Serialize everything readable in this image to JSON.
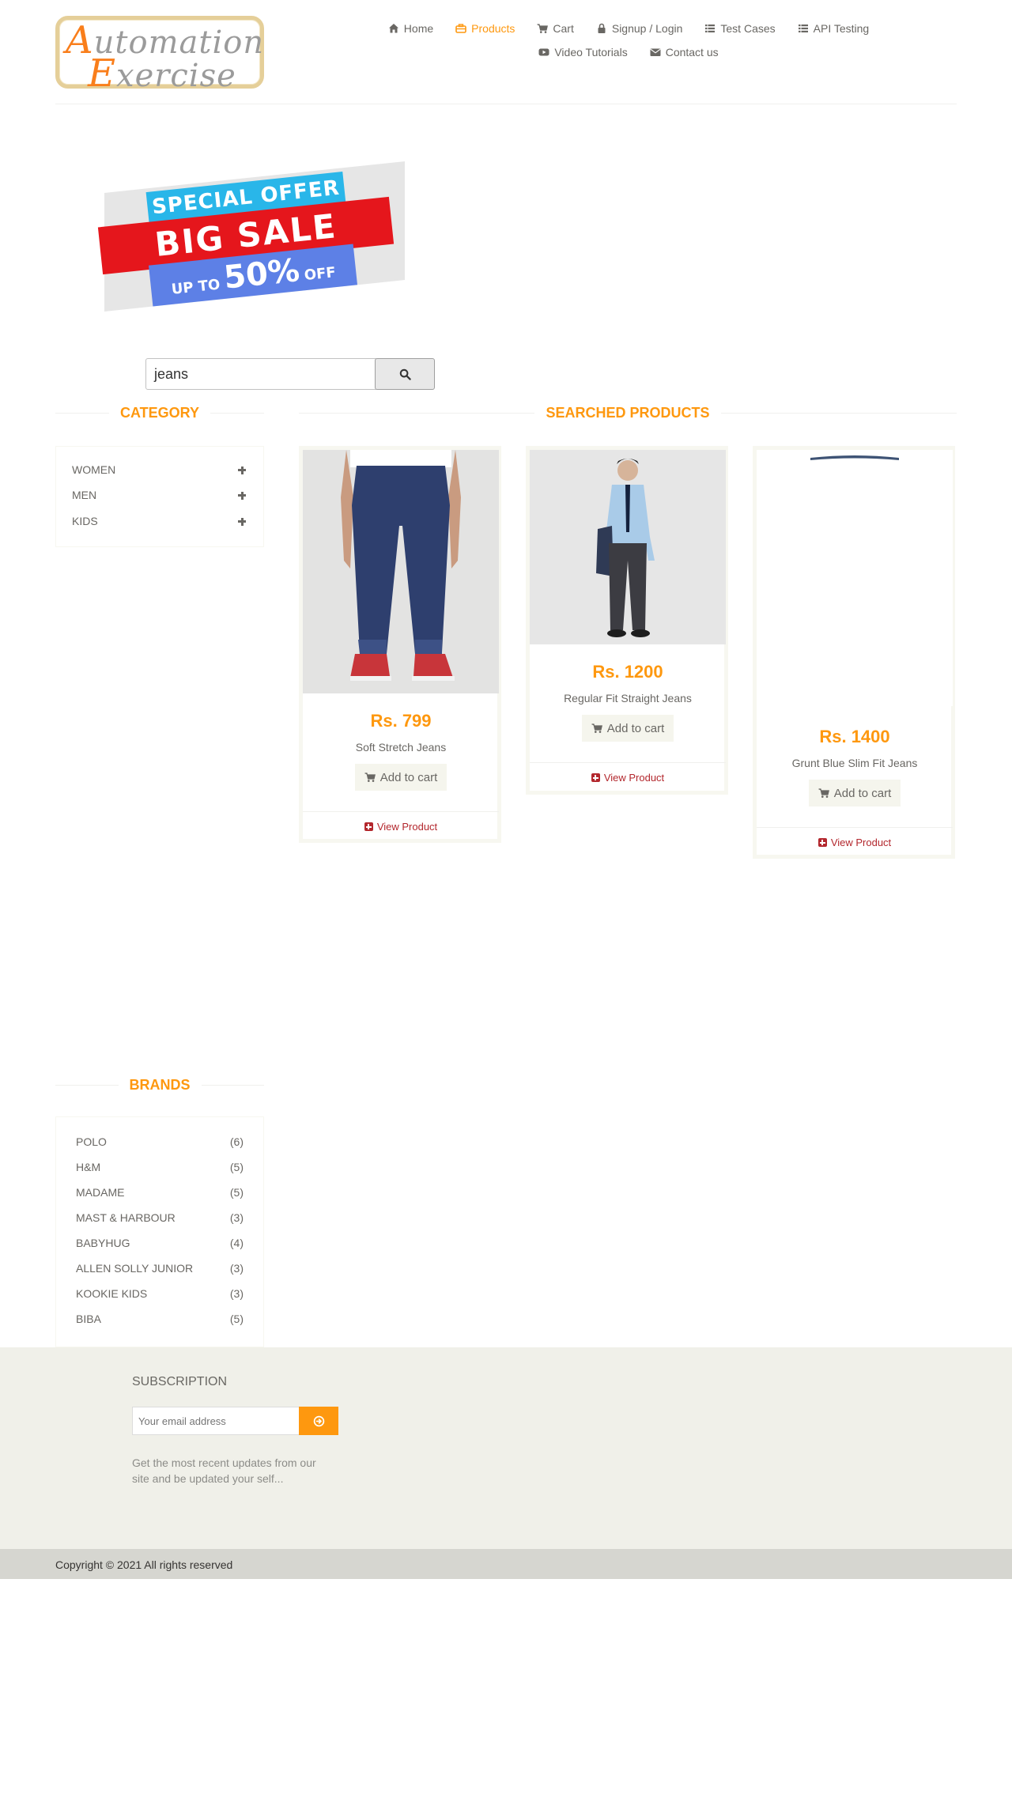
{
  "logo": {
    "line1_cap": "A",
    "line1_rest": "utomation",
    "line2_cap": "E",
    "line2_rest": "xercise"
  },
  "nav": {
    "home": "Home",
    "products": "Products",
    "cart": "Cart",
    "signup_login": "Signup / Login",
    "test_cases": "Test Cases",
    "api_testing": "API Testing",
    "video_tutorials": "Video Tutorials",
    "contact_us": "Contact us"
  },
  "banner": {
    "line1": "SPECIAL OFFER",
    "line2": "BIG SALE",
    "line3_up": "UP TO",
    "line3_pct": "50%",
    "line3_off": "OFF"
  },
  "search": {
    "value": "jeans"
  },
  "category": {
    "title": "Category",
    "items": [
      {
        "label": "Women"
      },
      {
        "label": "Men"
      },
      {
        "label": "Kids"
      }
    ]
  },
  "products_section": {
    "title": "Searched Products",
    "add_to_cart": "Add to cart",
    "view_product": "View Product",
    "items": [
      {
        "price": "Rs. 799",
        "name": "Soft Stretch Jeans"
      },
      {
        "price": "Rs. 1200",
        "name": "Regular Fit Straight Jeans"
      },
      {
        "price": "Rs. 1400",
        "name": "Grunt Blue Slim Fit Jeans"
      }
    ]
  },
  "brands": {
    "title": "Brands",
    "items": [
      {
        "name": "Polo",
        "count": "(6)"
      },
      {
        "name": "H&M",
        "count": "(5)"
      },
      {
        "name": "Madame",
        "count": "(5)"
      },
      {
        "name": "Mast & Harbour",
        "count": "(3)"
      },
      {
        "name": "Babyhug",
        "count": "(4)"
      },
      {
        "name": "Allen Solly Junior",
        "count": "(3)"
      },
      {
        "name": "Kookie Kids",
        "count": "(3)"
      },
      {
        "name": "Biba",
        "count": "(5)"
      }
    ]
  },
  "footer": {
    "subscription_title": "Subscription",
    "email_placeholder": "Your email address",
    "subscription_text": "Get the most recent updates from our site and be updated your self...",
    "copyright": "Copyright © 2021 All rights reserved"
  },
  "colors": {
    "accent": "#fe980f",
    "link_red": "#b3272d",
    "text": "#696763",
    "footer_bg": "#f0f0e9",
    "footer_bottom_bg": "#d6d6d0"
  }
}
